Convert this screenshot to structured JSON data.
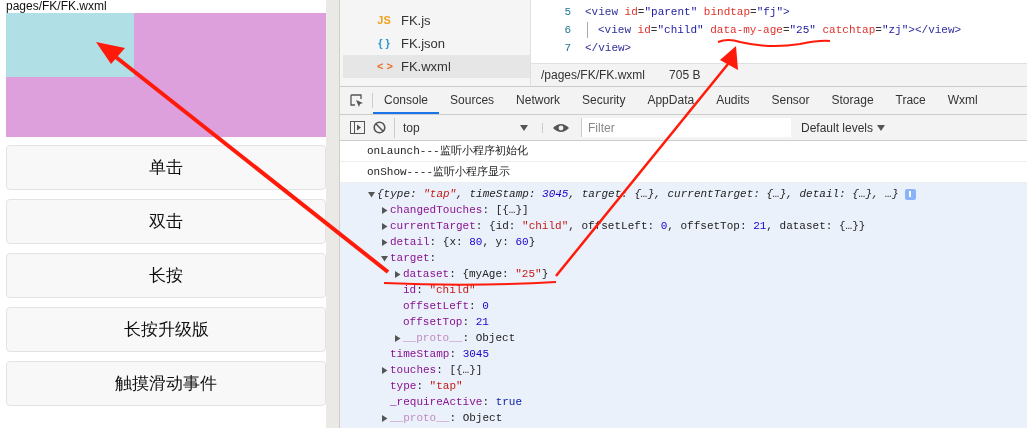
{
  "simulator": {
    "page_path": "pages/FK/FK.wxml",
    "buttons": [
      "单击",
      "双击",
      "长按",
      "长按升级版",
      "触摸滑动事件"
    ]
  },
  "file_tree": [
    {
      "icon": "JS",
      "color": "#f0a020",
      "name": "FK.js",
      "selected": false
    },
    {
      "icon": "{ }",
      "color": "#2b9bd8",
      "name": "FK.json",
      "selected": false
    },
    {
      "icon": "< >",
      "color": "#e8702a",
      "name": "FK.wxml",
      "selected": true
    }
  ],
  "editor": {
    "lines": [
      {
        "number": "5",
        "indent": false,
        "segments": [
          {
            "text": "<view",
            "kind": "tag"
          },
          {
            "text": " id",
            "kind": "attr"
          },
          {
            "text": "=",
            "kind": "punct"
          },
          {
            "text": "\"parent\"",
            "kind": "value"
          },
          {
            "text": " bindtap",
            "kind": "attr"
          },
          {
            "text": "=",
            "kind": "punct"
          },
          {
            "text": "\"fj\"",
            "kind": "value"
          },
          {
            "text": ">",
            "kind": "tag"
          }
        ]
      },
      {
        "number": "6",
        "indent": true,
        "segments": [
          {
            "text": "<view",
            "kind": "tag"
          },
          {
            "text": " id",
            "kind": "attr"
          },
          {
            "text": "=",
            "kind": "punct"
          },
          {
            "text": "\"child\"",
            "kind": "value"
          },
          {
            "text": " data-my-age",
            "kind": "attr"
          },
          {
            "text": "=",
            "kind": "punct"
          },
          {
            "text": "\"25\"",
            "kind": "value"
          },
          {
            "text": "  catchtap",
            "kind": "attr"
          },
          {
            "text": "=",
            "kind": "punct"
          },
          {
            "text": "\"zj\"",
            "kind": "value"
          },
          {
            "text": "></view>",
            "kind": "tag"
          }
        ]
      },
      {
        "number": "7",
        "indent": false,
        "segments": [
          {
            "text": "</view>",
            "kind": "tag"
          }
        ]
      }
    ]
  },
  "status_bar": {
    "path": "/pages/FK/FK.wxml",
    "size": "705 B"
  },
  "devtools": {
    "tabs": [
      {
        "label": "Console",
        "selected": true
      },
      {
        "label": "Sources",
        "selected": false
      },
      {
        "label": "Network",
        "selected": false
      },
      {
        "label": "Security",
        "selected": false
      },
      {
        "label": "AppData",
        "selected": false
      },
      {
        "label": "Audits",
        "selected": false
      },
      {
        "label": "Sensor",
        "selected": false
      },
      {
        "label": "Storage",
        "selected": false
      },
      {
        "label": "Trace",
        "selected": false
      },
      {
        "label": "Wxml",
        "selected": false
      }
    ],
    "context": "top",
    "filter_placeholder": "Filter",
    "levels": "Default levels"
  },
  "console": {
    "messages": [
      {
        "kind": "log",
        "text": "onLaunch---监听小程序初始化"
      },
      {
        "kind": "log",
        "text": "onShow----监听小程序显示"
      }
    ],
    "object": {
      "expanded": true,
      "segments": [
        {
          "text": "{type: ",
          "kind": "plain"
        },
        {
          "text": "\"tap\"",
          "kind": "string"
        },
        {
          "text": ", timeStamp: ",
          "kind": "plain"
        },
        {
          "text": "3045",
          "kind": "number"
        },
        {
          "text": ", target: {…}, currentTarget: {…}, detail: {…}, …}",
          "kind": "plain"
        }
      ],
      "children": [
        {
          "key": "changedTouches",
          "expanded": false,
          "dim": false,
          "segments": [
            {
              "text": ": ",
              "kind": "plain"
            },
            {
              "text": "[{…}]",
              "kind": "plain"
            }
          ]
        },
        {
          "key": "currentTarget",
          "expanded": false,
          "dim": false,
          "segments": [
            {
              "text": ": ",
              "kind": "plain"
            },
            {
              "text": "{id: ",
              "kind": "plain"
            },
            {
              "text": "\"child\"",
              "kind": "string"
            },
            {
              "text": ", offsetLeft: ",
              "kind": "plain"
            },
            {
              "text": "0",
              "kind": "number"
            },
            {
              "text": ", offsetTop: ",
              "kind": "plain"
            },
            {
              "text": "21",
              "kind": "number"
            },
            {
              "text": ", dataset: {…}}",
              "kind": "plain"
            }
          ]
        },
        {
          "key": "detail",
          "expanded": false,
          "dim": false,
          "segments": [
            {
              "text": ": ",
              "kind": "plain"
            },
            {
              "text": "{x: ",
              "kind": "plain"
            },
            {
              "text": "80",
              "kind": "number"
            },
            {
              "text": ", y: ",
              "kind": "plain"
            },
            {
              "text": "60",
              "kind": "number"
            },
            {
              "text": "}",
              "kind": "plain"
            }
          ]
        },
        {
          "key": "target",
          "expanded": true,
          "dim": false,
          "segments": [
            {
              "text": ":",
              "kind": "plain"
            }
          ],
          "children": [
            {
              "key": "dataset",
              "expanded": false,
              "dim": false,
              "segments": [
                {
                  "text": ": ",
                  "kind": "plain"
                },
                {
                  "text": "{myAge: ",
                  "kind": "plain"
                },
                {
                  "text": "\"25\"",
                  "kind": "string"
                },
                {
                  "text": "}",
                  "kind": "plain"
                }
              ]
            },
            {
              "key": "id",
              "dim": false,
              "segments": [
                {
                  "text": ": ",
                  "kind": "plain"
                },
                {
                  "text": "\"child\"",
                  "kind": "string"
                }
              ]
            },
            {
              "key": "offsetLeft",
              "dim": false,
              "segments": [
                {
                  "text": ": ",
                  "kind": "plain"
                },
                {
                  "text": "0",
                  "kind": "number"
                }
              ]
            },
            {
              "key": "offsetTop",
              "dim": false,
              "segments": [
                {
                  "text": ": ",
                  "kind": "plain"
                },
                {
                  "text": "21",
                  "kind": "number"
                }
              ]
            },
            {
              "key": "__proto__",
              "expanded": false,
              "dim": true,
              "segments": [
                {
                  "text": ": ",
                  "kind": "plain"
                },
                {
                  "text": "Object",
                  "kind": "plain"
                }
              ]
            }
          ]
        },
        {
          "key": "timeStamp",
          "dim": false,
          "segments": [
            {
              "text": ": ",
              "kind": "plain"
            },
            {
              "text": "3045",
              "kind": "number"
            }
          ]
        },
        {
          "key": "touches",
          "expanded": false,
          "dim": false,
          "segments": [
            {
              "text": ": ",
              "kind": "plain"
            },
            {
              "text": "[{…}]",
              "kind": "plain"
            }
          ]
        },
        {
          "key": "type",
          "dim": false,
          "segments": [
            {
              "text": ": ",
              "kind": "plain"
            },
            {
              "text": "\"tap\"",
              "kind": "string"
            }
          ]
        },
        {
          "key": "_requireActive",
          "dim": false,
          "segments": [
            {
              "text": ": ",
              "kind": "plain"
            },
            {
              "text": "true",
              "kind": "bool"
            }
          ]
        },
        {
          "key": "__proto__",
          "expanded": false,
          "dim": true,
          "segments": [
            {
              "text": ": ",
              "kind": "plain"
            },
            {
              "text": "Object",
              "kind": "plain"
            }
          ]
        }
      ]
    }
  }
}
